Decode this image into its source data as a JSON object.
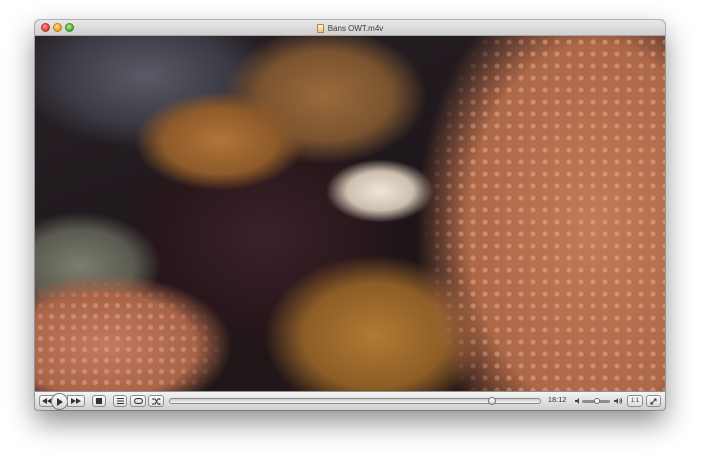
{
  "window": {
    "title": "Bans OWT.m4v"
  },
  "player": {
    "elapsed_time": "18:12",
    "progress_fraction": 0.875,
    "volume_fraction": 0.55,
    "aspect_label": "1:1"
  },
  "icons": {
    "title_file": "document-icon",
    "rewind": "rewind-icon",
    "play": "play-icon",
    "fast_forward": "fast-forward-icon",
    "stop": "stop-icon",
    "playlist": "playlist-icon",
    "loop": "loop-icon",
    "shuffle": "shuffle-icon",
    "volume_low": "speaker-low-icon",
    "volume_high": "speaker-high-icon",
    "fullscreen": "fullscreen-icon"
  }
}
